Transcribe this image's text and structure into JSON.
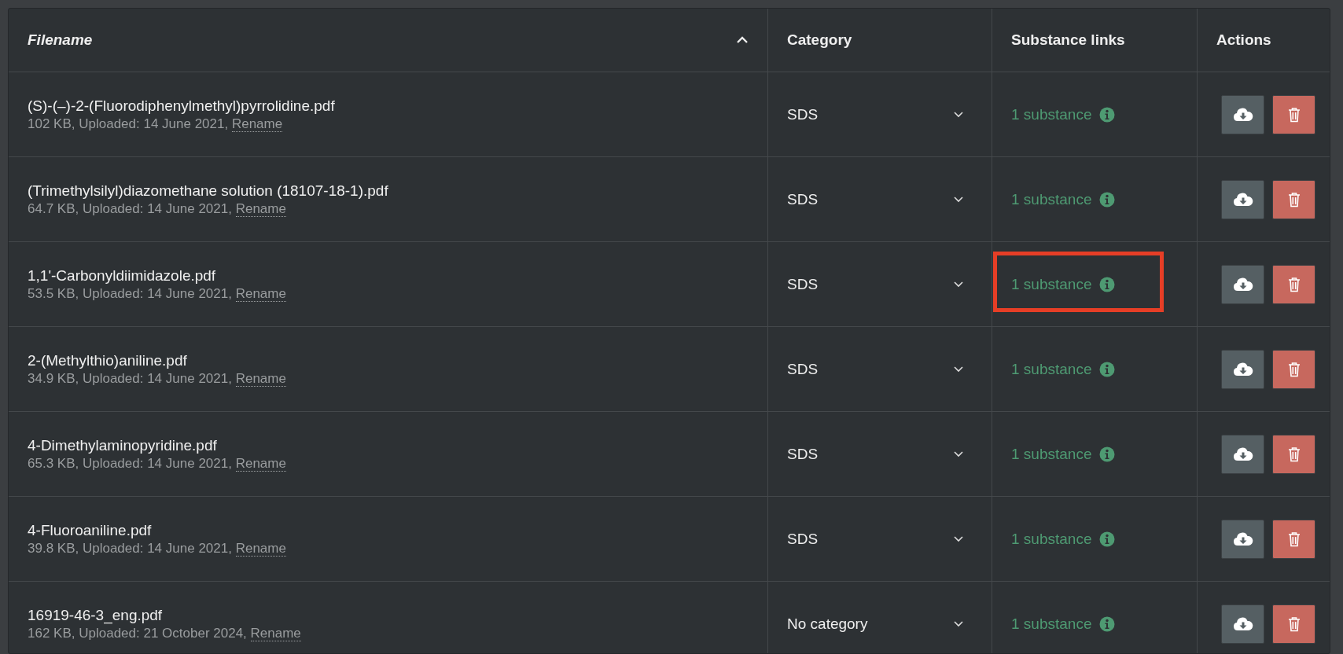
{
  "table": {
    "columns": [
      {
        "label": "Filename",
        "sorted": true
      },
      {
        "label": "Category",
        "sorted": false
      },
      {
        "label": "Substance links",
        "sorted": false
      },
      {
        "label": "Actions",
        "sorted": false
      }
    ],
    "rows": [
      {
        "filename": "(S)-(–)-2-(Fluorodiphenylmethyl)pyrrolidine.pdf",
        "details": "102 KB, Uploaded: 14 June 2021,",
        "rename": "Rename",
        "category": "SDS",
        "substances": "1 substance",
        "highlighted": false
      },
      {
        "filename": "(Trimethylsilyl)diazomethane solution (18107-18-1).pdf",
        "details": "64.7 KB, Uploaded: 14 June 2021,",
        "rename": "Rename",
        "category": "SDS",
        "substances": "1 substance",
        "highlighted": false
      },
      {
        "filename": "1,1'-Carbonyldiimidazole.pdf",
        "details": "53.5 KB, Uploaded: 14 June 2021,",
        "rename": "Rename",
        "category": "SDS",
        "substances": "1 substance",
        "highlighted": true
      },
      {
        "filename": "2-(Methylthio)aniline.pdf",
        "details": "34.9 KB, Uploaded: 14 June 2021,",
        "rename": "Rename",
        "category": "SDS",
        "substances": "1 substance",
        "highlighted": false
      },
      {
        "filename": "4-Dimethylaminopyridine.pdf",
        "details": "65.3 KB, Uploaded: 14 June 2021,",
        "rename": "Rename",
        "category": "SDS",
        "substances": "1 substance",
        "highlighted": false
      },
      {
        "filename": "4-Fluoroaniline.pdf",
        "details": "39.8 KB, Uploaded: 14 June 2021,",
        "rename": "Rename",
        "category": "SDS",
        "substances": "1 substance",
        "highlighted": false
      },
      {
        "filename": "16919-46-3_eng.pdf",
        "details": "162 KB, Uploaded: 21 October 2024,",
        "rename": "Rename",
        "category": "No category",
        "substances": "1 substance",
        "highlighted": false
      }
    ]
  }
}
